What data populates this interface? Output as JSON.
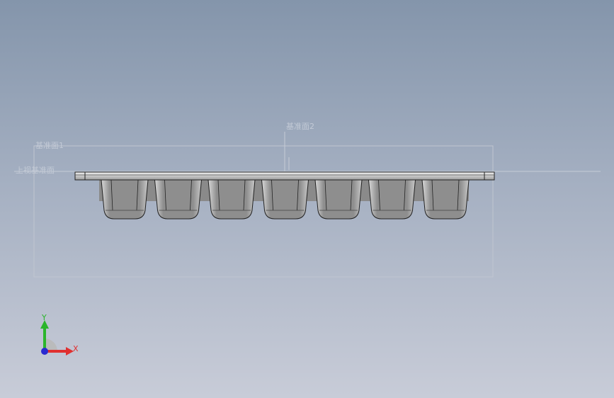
{
  "window": {
    "background_top": "#8495ab",
    "background_bottom": "#c8ccd8"
  },
  "planes": {
    "plane_1": "基准面1",
    "plane_2": "基准面2",
    "top_plane": "上视基准面"
  },
  "part": {
    "cavity_count": 7,
    "color_body": "#9a9a9a",
    "color_edge": "#222222"
  },
  "triad": {
    "x_label": "X",
    "y_label": "Y",
    "x_color": "#e03030",
    "y_color": "#2bb52b",
    "z_color": "#2a2ad0"
  }
}
